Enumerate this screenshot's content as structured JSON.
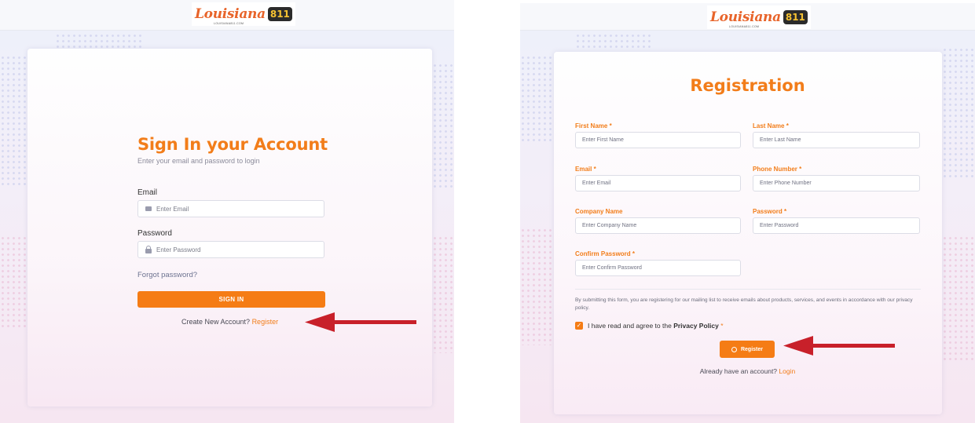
{
  "left_panel": {
    "logo": {
      "text": "Louisiana",
      "badge": "811",
      "sub": "LOUISIANA811.COM"
    },
    "title": "Sign In your Account",
    "subtitle": "Enter your email and password to login",
    "email_label": "Email",
    "email_placeholder": "Enter Email",
    "password_label": "Password",
    "password_placeholder": "Enter Password",
    "forgot_link": "Forgot password?",
    "signin_button": "SIGN IN",
    "create_text": "Create New Account?",
    "register_link": "Register"
  },
  "right_panel": {
    "logo": {
      "text": "Louisiana",
      "badge": "811",
      "sub": "LOUISIANA811.COM"
    },
    "title": "Registration",
    "fields": {
      "first_name": {
        "label": "First Name",
        "placeholder": "Enter First Name"
      },
      "last_name": {
        "label": "Last Name",
        "placeholder": "Enter Last Name"
      },
      "email": {
        "label": "Email",
        "placeholder": "Enter Email"
      },
      "phone": {
        "label": "Phone Number",
        "placeholder": "Enter Phone Number"
      },
      "company": {
        "label": "Company Name",
        "placeholder": "Enter Company Name"
      },
      "password": {
        "label": "Password",
        "placeholder": "Enter Password"
      },
      "confirm_password": {
        "label": "Confirm Password",
        "placeholder": "Enter Confirm Password"
      }
    },
    "required_marker": "*",
    "notice": "By submitting this form, you are registering for our mailing list to receive emails about products, services, and events in accordance with our privacy policy.",
    "agree_prefix": "I have read and agree to the",
    "agree_link": "Privacy Policy",
    "register_button": "Register",
    "already_text": "Already have an account?",
    "login_link": "Login"
  },
  "colors": {
    "accent": "#f57c15",
    "arrow": "#c8202a"
  }
}
